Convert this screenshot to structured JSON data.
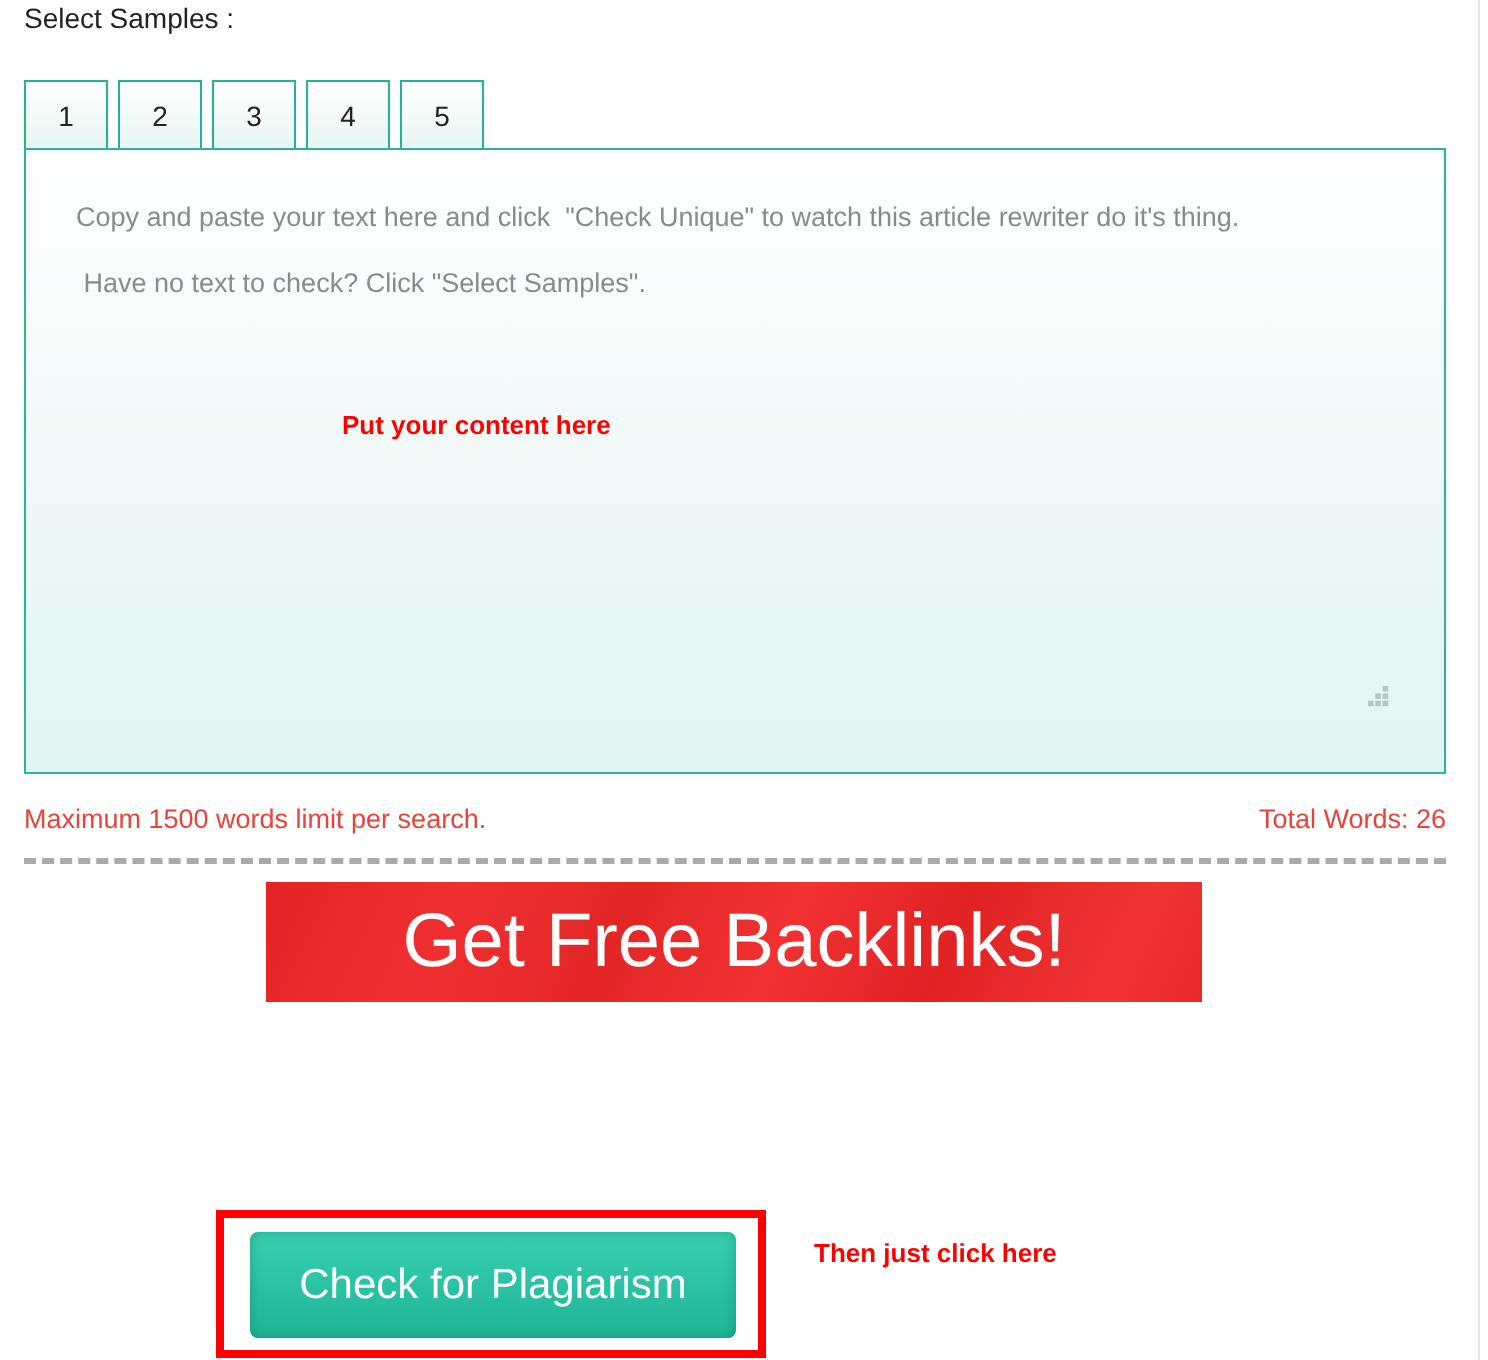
{
  "heading": "Select Samples :",
  "tabs": [
    {
      "label": "1",
      "selected": false
    },
    {
      "label": "2",
      "selected": false
    },
    {
      "label": "3",
      "selected": false
    },
    {
      "label": "4",
      "selected": false
    },
    {
      "label": "5",
      "selected": false
    }
  ],
  "editor": {
    "placeholder_lines": [
      "Copy and paste your text here and click  \"Check Unique\" to watch this article rewriter do it's thing.",
      " Have no text to check? Click \"Select Samples\"."
    ],
    "annotation": "Put your content here"
  },
  "limit_note": "Maximum 1500 words limit per search.",
  "word_count": "Total Words: 26",
  "banner": {
    "text": "Get Free Backlinks!"
  },
  "submit": {
    "label": "Check for Plagiarism",
    "annotation": "Then just click here"
  }
}
